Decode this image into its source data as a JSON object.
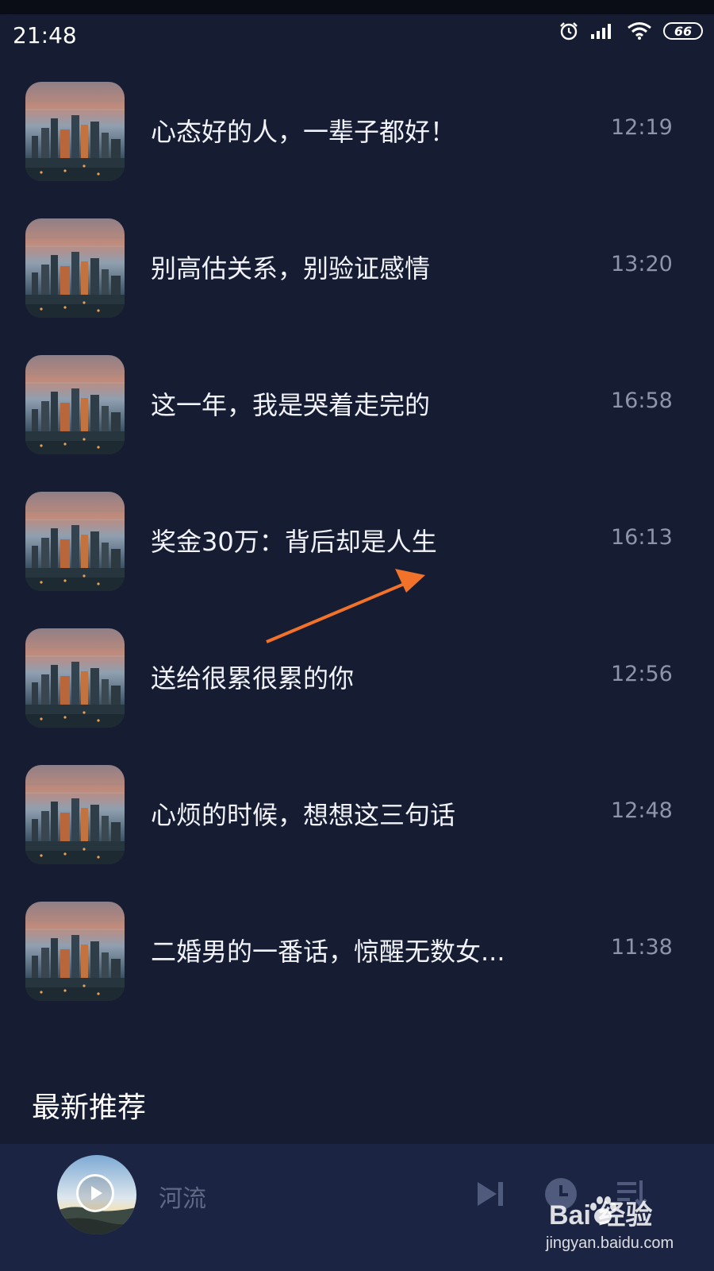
{
  "status_bar": {
    "time": "21:48",
    "battery": "66",
    "icons": [
      "alarm-icon",
      "signal-icon",
      "wifi-icon",
      "battery-icon"
    ]
  },
  "playlist": {
    "items": [
      {
        "title": "心态好的人，一辈子都好！",
        "time": "12:19"
      },
      {
        "title": "别高估关系，别验证感情",
        "time": "13:20"
      },
      {
        "title": "这一年，我是哭着走完的",
        "time": "16:58"
      },
      {
        "title": "奖金30万：背后却是人生",
        "time": "16:13"
      },
      {
        "title": "送给很累很累的你",
        "time": "12:56"
      },
      {
        "title": "心烦的时候，想想这三句话",
        "time": "12:48"
      },
      {
        "title": "二婚男的一番话，惊醒无数女...",
        "time": "11:38"
      }
    ]
  },
  "section": {
    "title": "最新推荐"
  },
  "player": {
    "song": "河流",
    "controls": [
      "next-icon",
      "timer-icon",
      "playlist-icon"
    ]
  },
  "watermark": {
    "logo": "Bai 经验",
    "url": "jingyan.baidu.com"
  },
  "colors": {
    "background": "#161d33",
    "player_background": "#1b2442",
    "arrow": "#f2722a",
    "title_text": "#f1f3f8",
    "time_text": "#8d95a8"
  }
}
